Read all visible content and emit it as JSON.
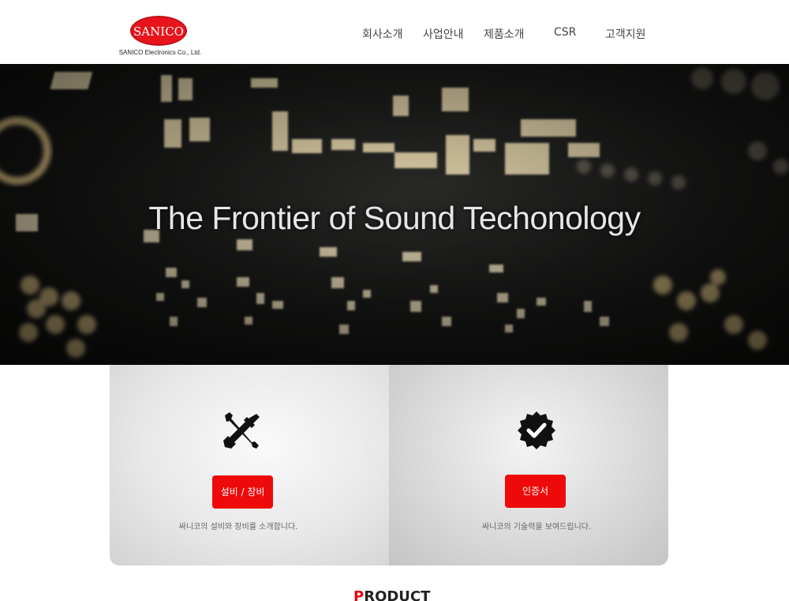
{
  "header": {
    "logo_text": "SANICO",
    "logo_subtext": "SANICO Electronics Co., Ltd.",
    "nav": [
      "회사소개",
      "사업안내",
      "제품소개",
      "CSR",
      "고객지원"
    ]
  },
  "hero": {
    "title": "The Frontier of Sound Techonology"
  },
  "cards": [
    {
      "icon": "tools-icon",
      "button": "설비 / 장비",
      "description": "싸니코의 설비와 장비를 소개합니다."
    },
    {
      "icon": "verified-badge-icon",
      "button": "인증서",
      "description": "싸니코의 기술력을 보여드립니다."
    }
  ],
  "product": {
    "title_first": "P",
    "title_rest": "RODUCT"
  },
  "colors": {
    "brand_red": "#e8141c",
    "button_red": "#ee0a0a",
    "hero_bg": "#161615"
  }
}
